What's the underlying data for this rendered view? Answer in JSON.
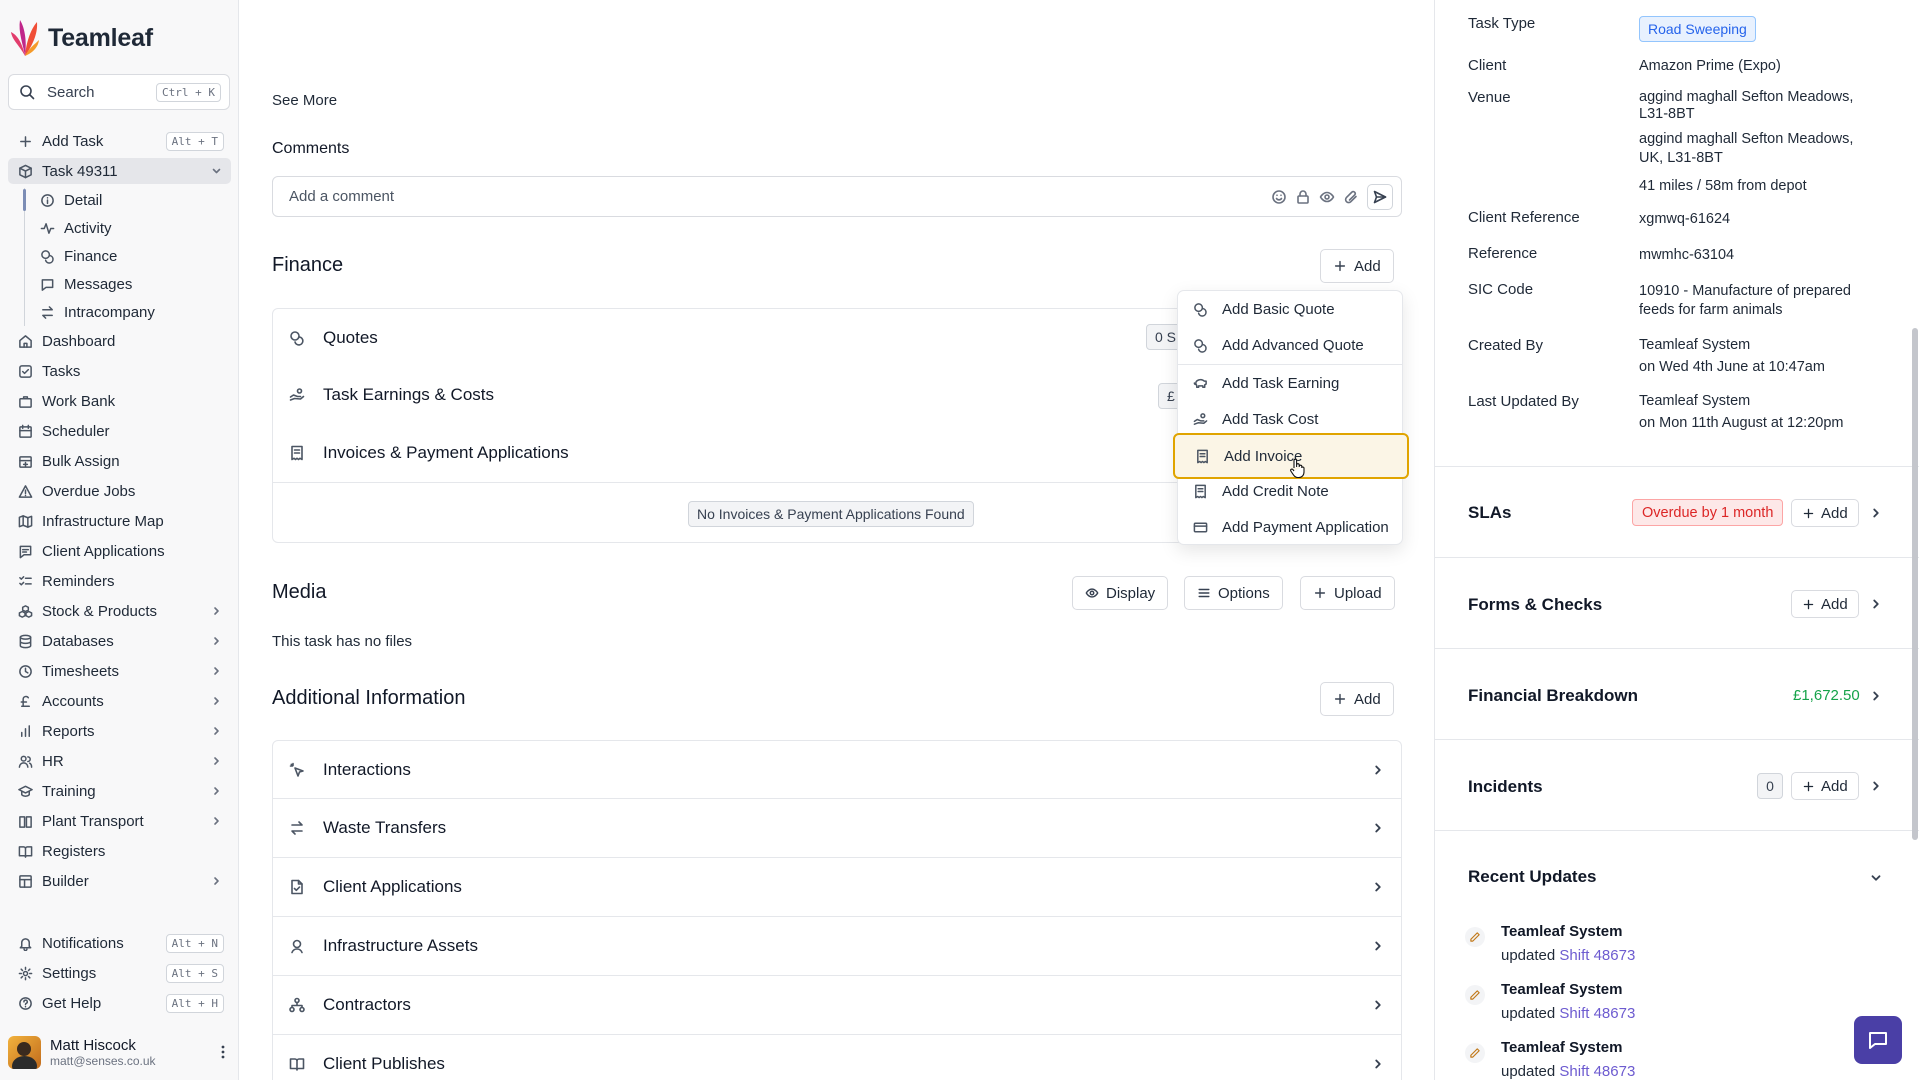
{
  "app": {
    "name": "Teamleaf"
  },
  "search": {
    "label": "Search",
    "shortcut": "Ctrl + K"
  },
  "sidebar": {
    "add_task": {
      "label": "Add Task",
      "shortcut": "Alt + T"
    },
    "task": {
      "label": "Task 49311"
    },
    "task_items": [
      "Detail",
      "Activity",
      "Finance",
      "Messages",
      "Intracompany"
    ],
    "items": [
      "Dashboard",
      "Tasks",
      "Work Bank",
      "Scheduler",
      "Bulk Assign",
      "Overdue Jobs",
      "Infrastructure Map",
      "Client Applications",
      "Reminders",
      "Stock & Products",
      "Databases",
      "Timesheets",
      "Accounts",
      "Reports",
      "HR",
      "Training",
      "Plant Transport",
      "Registers",
      "Builder"
    ],
    "bottom": [
      {
        "label": "Notifications",
        "shortcut": "Alt + N"
      },
      {
        "label": "Settings",
        "shortcut": "Alt + S"
      },
      {
        "label": "Get Help",
        "shortcut": "Alt + H"
      }
    ],
    "user": {
      "name": "Matt Hiscock",
      "email": "matt@senses.co.uk"
    }
  },
  "main": {
    "see_more": "See More",
    "comments": {
      "title": "Comments",
      "placeholder": "Add a comment"
    },
    "finance": {
      "title": "Finance",
      "add_label": "Add",
      "rows": [
        {
          "label": "Quotes",
          "count": "0 S"
        },
        {
          "label": "Task Earnings & Costs",
          "count": "£"
        },
        {
          "label": "Invoices & Payment Applications"
        }
      ],
      "empty": "No Invoices & Payment Applications Found"
    },
    "dropdown": [
      "Add Basic Quote",
      "Add Advanced Quote",
      "Add Task Earning",
      "Add Task Cost",
      "Add Invoice",
      "Add Credit Note",
      "Add Payment Application"
    ],
    "media": {
      "title": "Media",
      "display_label": "Display",
      "options_label": "Options",
      "upload_label": "Upload",
      "empty": "This task has no files"
    },
    "additional": {
      "title": "Additional Information",
      "add_label": "Add",
      "rows": [
        "Interactions",
        "Waste Transfers",
        "Client Applications",
        "Infrastructure Assets",
        "Contractors",
        "Client Publishes"
      ]
    }
  },
  "details": {
    "task_type": {
      "label": "Task Type",
      "value": "Road Sweeping"
    },
    "client": {
      "label": "Client",
      "value": "Amazon Prime (Expo)"
    },
    "venue": {
      "label": "Venue",
      "line1": "aggind maghall Sefton Meadows, L31-8BT",
      "line2": "aggind maghall Sefton Meadows, UK, L31-8BT",
      "distance": "41 miles / 58m from depot"
    },
    "client_reference": {
      "label": "Client Reference",
      "value": "xgmwq-61624"
    },
    "reference": {
      "label": "Reference",
      "value": "mwmhc-63104"
    },
    "sic_code": {
      "label": "SIC Code",
      "value": "10910 - Manufacture of prepared feeds for farm animals"
    },
    "created_by": {
      "label": "Created By",
      "who": "Teamleaf System",
      "when": "on Wed 4th June at 10:47am"
    },
    "last_updated_by": {
      "label": "Last Updated By",
      "who": "Teamleaf System",
      "when": "on Mon 11th August at 12:20pm"
    }
  },
  "right_sections": {
    "slas": {
      "title": "SLAs",
      "badge": "Overdue by 1 month",
      "add_label": "Add"
    },
    "forms": {
      "title": "Forms & Checks",
      "add_label": "Add"
    },
    "financial": {
      "title": "Financial Breakdown",
      "value": "£1,672.50"
    },
    "incidents": {
      "title": "Incidents",
      "count": "0",
      "add_label": "Add"
    },
    "recent": {
      "title": "Recent Updates",
      "items": [
        {
          "who": "Teamleaf System",
          "action": "updated",
          "link": "Shift 48673"
        },
        {
          "who": "Teamleaf System",
          "action": "updated",
          "link": "Shift 48673"
        },
        {
          "who": "Teamleaf System",
          "action": "updated",
          "link": "Shift 48673"
        }
      ]
    }
  },
  "colors": {
    "accent": "#4a3fa6",
    "highlight_border": "#e0a400",
    "overdue": "#dc2626",
    "money": "#16a34a",
    "tag_blue": "#2563eb"
  }
}
